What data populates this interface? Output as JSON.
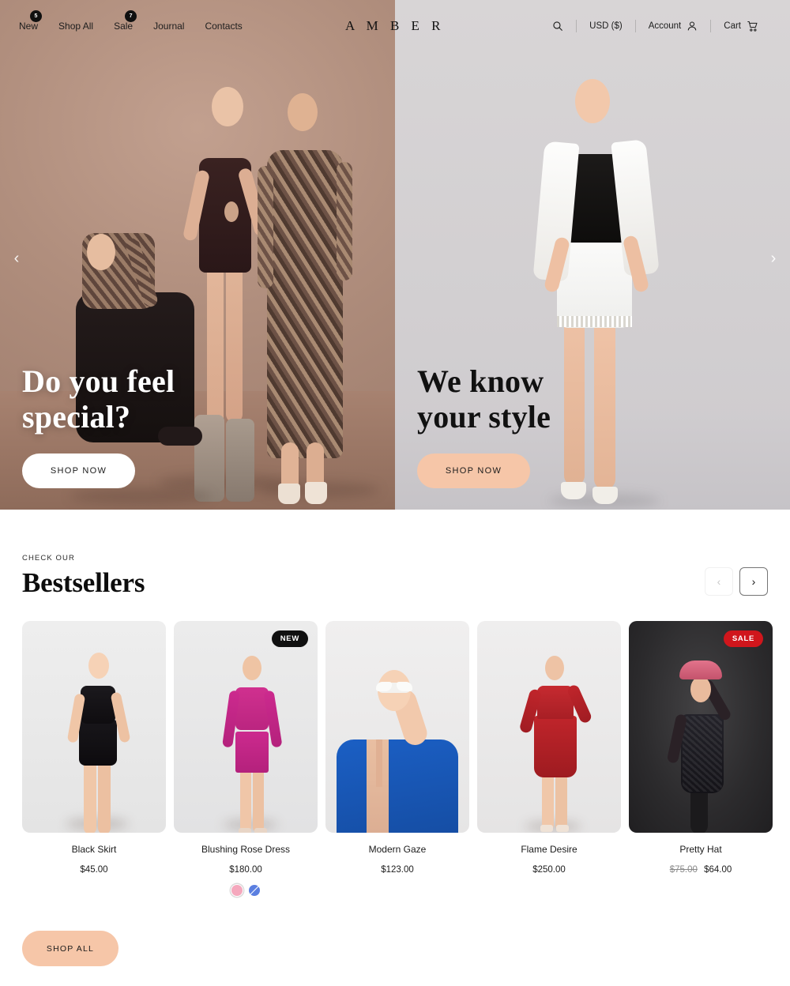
{
  "header": {
    "logo": "A M B E R",
    "nav": [
      {
        "label": "New",
        "badge": "5"
      },
      {
        "label": "Shop All",
        "badge": ""
      },
      {
        "label": "Sale",
        "badge": "7"
      },
      {
        "label": "Journal",
        "badge": ""
      },
      {
        "label": "Contacts",
        "badge": ""
      }
    ],
    "search_icon": "search-icon",
    "currency": "USD ($)",
    "account": "Account",
    "cart": "Cart"
  },
  "hero": {
    "prev_icon": "‹",
    "next_icon": "›",
    "slides": [
      {
        "headline_line1": "Do you feel",
        "headline_line2": "special?",
        "cta": "SHOP NOW",
        "theme": "light"
      },
      {
        "headline_line1": "We know",
        "headline_line2": "your style",
        "cta": "SHOP NOW",
        "theme": "dark"
      }
    ]
  },
  "bestsellers": {
    "kicker": "CHECK OUR",
    "title": "Bestsellers",
    "prev_icon": "‹",
    "next_icon": "›",
    "shop_all": "SHOP ALL",
    "products": [
      {
        "title": "Black Skirt",
        "price": "$45.00",
        "old_price": "",
        "badge": "",
        "swatches": []
      },
      {
        "title": "Blushing Rose Dress",
        "price": "$180.00",
        "old_price": "",
        "badge": "NEW",
        "swatches": [
          {
            "color": "#f5a8bd",
            "state": "selected"
          },
          {
            "color": "#5b7fe0",
            "state": "sold-out"
          }
        ]
      },
      {
        "title": "Modern Gaze",
        "price": "$123.00",
        "old_price": "",
        "badge": "",
        "swatches": []
      },
      {
        "title": "Flame Desire",
        "price": "$250.00",
        "old_price": "",
        "badge": "",
        "swatches": []
      },
      {
        "title": "Pretty Hat",
        "price": "$64.00",
        "old_price": "$75.00",
        "badge": "SALE",
        "swatches": []
      }
    ]
  },
  "colors": {
    "accent_peach": "#f6c6a8",
    "sale_red": "#d0161c",
    "badge_black": "#101010"
  }
}
